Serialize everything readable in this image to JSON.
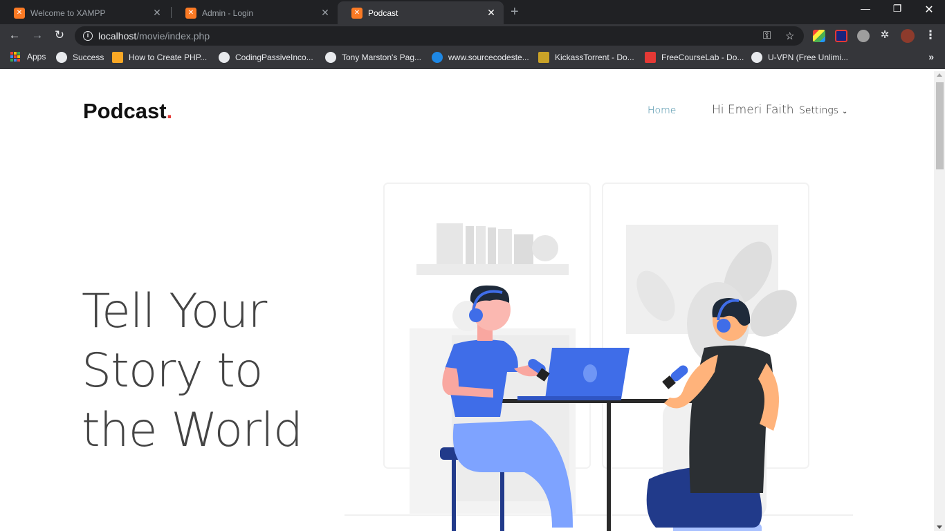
{
  "browser": {
    "tabs": [
      {
        "title": "Welcome to XAMPP",
        "active": false
      },
      {
        "title": "Admin - Login",
        "active": false
      },
      {
        "title": "Podcast",
        "active": true
      }
    ],
    "url_host": "localhost",
    "url_path": "/movie/index.php",
    "bookmarks": [
      "Apps",
      "Success",
      "How to Create PHP...",
      "CodingPassiveInco...",
      "Tony Marston's Pag...",
      "www.sourcecodeste...",
      "KickassTorrent - Do...",
      "FreeCourseLab - Do...",
      "U-VPN (Free Unlimi..."
    ]
  },
  "site": {
    "logo_text": "Podcast",
    "logo_dot": ".",
    "nav": {
      "home": "Home",
      "user_greeting": "Hi Emeri Faith",
      "settings": "Settings"
    },
    "hero_lines": [
      "Tell Your",
      "Story to",
      "the World"
    ]
  },
  "colors": {
    "accent_blue": "#3f6de8",
    "logo_dot": "#e53935",
    "nav_home": "#4a90a8"
  }
}
